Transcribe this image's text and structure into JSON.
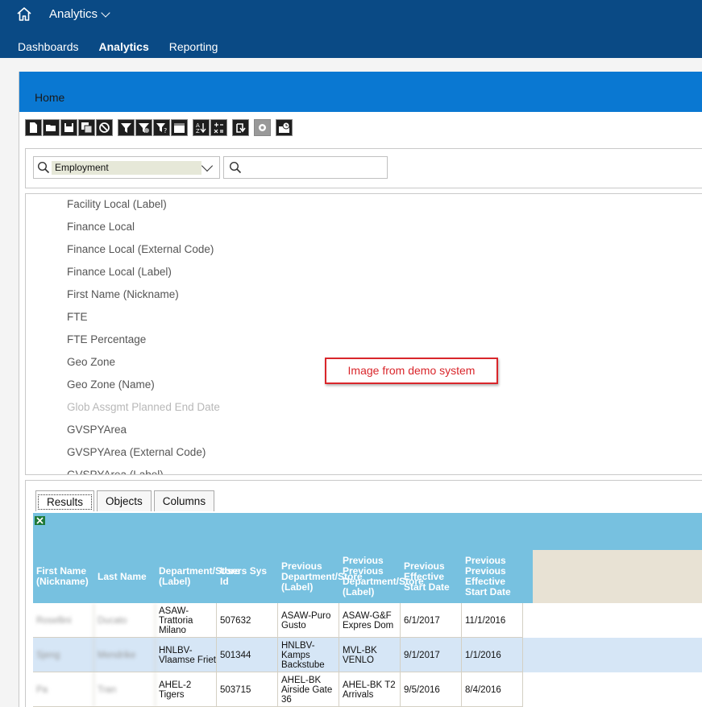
{
  "shell": {
    "app_title": "Analytics",
    "nav": [
      "Dashboards",
      "Analytics",
      "Reporting"
    ],
    "active_nav": "Analytics"
  },
  "breadcrumb": "Home",
  "toolbar": {
    "icons": [
      "new-icon",
      "open-icon",
      "save-icon",
      "save-as-icon",
      "cancel-icon",
      "filter-icon",
      "filter-settings-icon",
      "filter-help-icon",
      "calendar-icon",
      "sort-icon",
      "calculate-icon",
      "refresh-icon",
      "settings-icon",
      "schedule-icon"
    ]
  },
  "search": {
    "category_value": "Employment",
    "search_value": ""
  },
  "fields": [
    {
      "label": "Facility Local (Label)",
      "disabled": false
    },
    {
      "label": "Finance Local",
      "disabled": false
    },
    {
      "label": "Finance Local (External Code)",
      "disabled": false
    },
    {
      "label": "Finance Local (Label)",
      "disabled": false
    },
    {
      "label": "First Name (Nickname)",
      "disabled": false
    },
    {
      "label": "FTE",
      "disabled": false
    },
    {
      "label": "FTE Percentage",
      "disabled": false
    },
    {
      "label": "Geo Zone",
      "disabled": false
    },
    {
      "label": "Geo Zone (Name)",
      "disabled": false
    },
    {
      "label": "Glob Assgmt Planned End Date",
      "disabled": true
    },
    {
      "label": "GVSPYArea",
      "disabled": false
    },
    {
      "label": "GVSPYArea (External Code)",
      "disabled": false
    },
    {
      "label": "GVSPYArea (Label)",
      "disabled": false
    }
  ],
  "demo_note": "Image from demo system",
  "tabs": [
    "Results",
    "Objects",
    "Columns"
  ],
  "active_tab": "Results",
  "results": {
    "columns": [
      "First Name (Nickname)",
      "Last Name",
      "Department/Store (Label)",
      "Users Sys Id",
      "Previous Department/Store (Label)",
      "Previous Previous Department/Store (Label)",
      "Previous Effective Start Date",
      "Previous Previous Effective Start Date"
    ],
    "rows": [
      [
        "Rosellini",
        "Ducato",
        "ASAW-Trattoria Milano",
        "507632",
        "ASAW-Puro Gusto",
        "ASAW-G&F Expres Dom",
        "6/1/2017",
        "11/1/2016"
      ],
      [
        "Sjeng",
        "Mendrike",
        "HNLBV-Vlaamse Friet",
        "501344",
        "HNLBV-Kamps Backstube",
        "MVL-BK VENLO",
        "9/1/2017",
        "1/1/2016"
      ],
      [
        "Pa",
        "Tran",
        "AHEL-2 Tigers",
        "503715",
        "AHEL-BK Airside Gate 36",
        "AHEL-BK T2 Arrivals",
        "9/5/2016",
        "8/4/2016"
      ]
    ]
  },
  "colors": {
    "shell": "#0a4a85",
    "home_bar": "#0a78d2",
    "grid_header": "#77c1e0",
    "alt_row": "#d6e6f6",
    "note_red": "#d9262b"
  }
}
